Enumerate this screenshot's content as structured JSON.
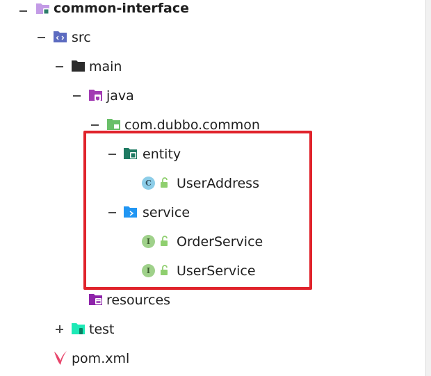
{
  "tree": {
    "root": {
      "label": "common-interface",
      "expanded": true
    },
    "src": {
      "label": "src",
      "expanded": true
    },
    "main": {
      "label": "main",
      "expanded": true
    },
    "java": {
      "label": "java",
      "expanded": true
    },
    "package": {
      "label": "com.dubbo.common",
      "expanded": true
    },
    "entity": {
      "label": "entity",
      "expanded": true
    },
    "user_address": {
      "label": "UserAddress",
      "badge": "C"
    },
    "service": {
      "label": "service",
      "expanded": true
    },
    "order_service": {
      "label": "OrderService",
      "badge": "I"
    },
    "user_service": {
      "label": "UserService",
      "badge": "I"
    },
    "resources": {
      "label": "resources"
    },
    "test": {
      "label": "test",
      "expanded": false
    },
    "pom": {
      "label": "pom.xml"
    }
  },
  "colors": {
    "highlight": "#e0232b",
    "module_folder": "#b77ee0",
    "source_folder": "#5c6bc0",
    "java_folder": "#9c27b0",
    "package_folder": "#66bb6a",
    "test_folder": "#1de9b6",
    "class_badge": "#8ccde8",
    "interface_badge": "#9fd18a"
  }
}
